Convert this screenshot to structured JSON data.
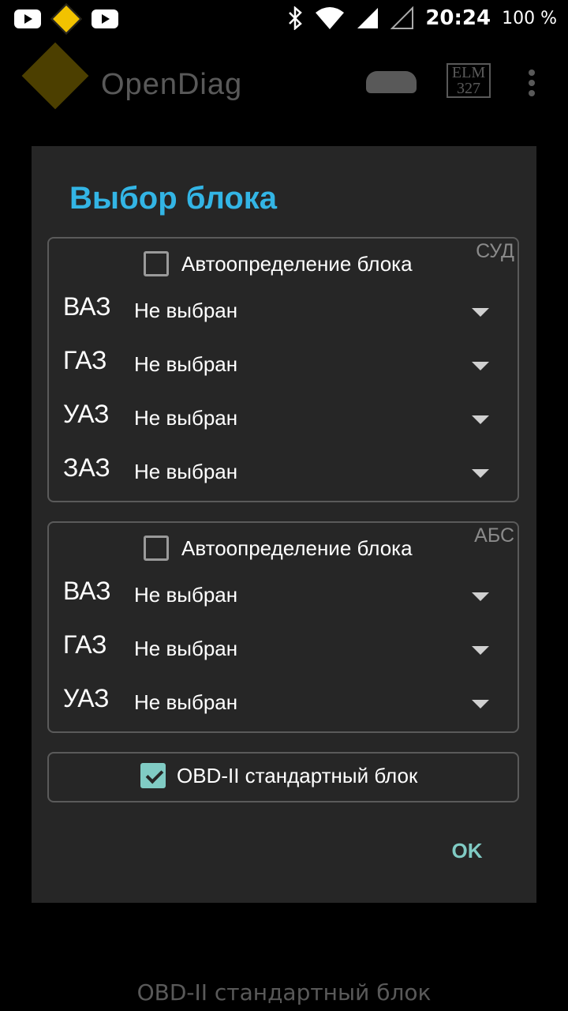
{
  "status_bar": {
    "time": "20:24",
    "battery": "100 %",
    "icons": [
      "youtube-icon",
      "navigation-icon",
      "youtube-icon",
      "bluetooth-icon",
      "wifi-icon",
      "signal-icon"
    ]
  },
  "app_bar": {
    "title": "OpenDiag",
    "elm_label_top": "ELM",
    "elm_label_bottom": "327"
  },
  "dialog": {
    "title": "Выбор блока",
    "group_ecu": {
      "tag": "СУД",
      "auto_label": "Автоопределение блока",
      "auto_checked": false,
      "rows": [
        {
          "brand": "ВАЗ",
          "value": "Не выбран"
        },
        {
          "brand": "ГАЗ",
          "value": "Не выбран"
        },
        {
          "brand": "УАЗ",
          "value": "Не выбран"
        },
        {
          "brand": "ЗАЗ",
          "value": "Не выбран"
        }
      ]
    },
    "group_abs": {
      "tag": "АБС",
      "auto_label": "Автоопределение блока",
      "auto_checked": false,
      "rows": [
        {
          "brand": "ВАЗ",
          "value": "Не выбран"
        },
        {
          "brand": "ГАЗ",
          "value": "Не выбран"
        },
        {
          "brand": "УАЗ",
          "value": "Не выбран"
        }
      ]
    },
    "obd": {
      "label": "OBD-II стандартный блок",
      "checked": true
    },
    "ok_label": "OK"
  },
  "background_bottom_text": "OBD-II стандартный блок"
}
